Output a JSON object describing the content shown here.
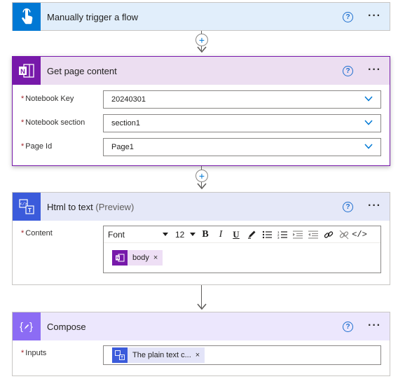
{
  "trigger": {
    "title": "Manually trigger a flow",
    "color": "#0078d4",
    "header_bg": "#e1eefb",
    "icon": "touch-hand-icon"
  },
  "get_page": {
    "title": "Get page content",
    "color": "#7719aa",
    "header_bg": "#ecdef1",
    "icon": "onenote-icon",
    "fields": [
      {
        "label": "Notebook Key",
        "value": "20240301"
      },
      {
        "label": "Notebook section",
        "value": "section1"
      },
      {
        "label": "Page Id",
        "value": "Page1"
      }
    ]
  },
  "html_to_text": {
    "title": "Html to text",
    "preview": "(Preview)",
    "color": "#3b5bdb",
    "header_bg": "#e5e8f8",
    "icon": "html-to-text-icon",
    "content_label": "Content",
    "toolbar": {
      "font": "Font",
      "size": "12",
      "bold": "B",
      "italic": "I",
      "underline": "U"
    },
    "token": {
      "label": "body",
      "remove": "×"
    }
  },
  "compose": {
    "title": "Compose",
    "color": "#8c6cf4",
    "header_bg": "#ece7fd",
    "icon": "compose-braces-icon",
    "inputs_label": "Inputs",
    "token": {
      "label": "The plain text c...",
      "remove": "×"
    }
  },
  "common": {
    "required_mark": "*",
    "help": "?",
    "more": "···"
  }
}
